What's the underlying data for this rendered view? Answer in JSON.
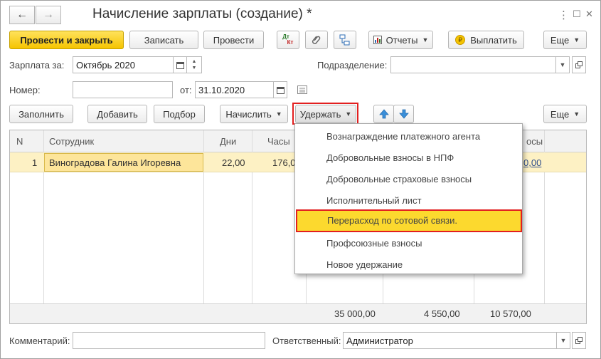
{
  "window": {
    "title": "Начисление зарплаты (создание) *",
    "back_icon": "←",
    "forward_icon": "→",
    "more_icon": "⋮",
    "maximize_icon": "☐",
    "close_icon": "✕"
  },
  "toolbar": {
    "post_close": "Провести и закрыть",
    "save": "Записать",
    "post": "Провести",
    "dt_kt_top": "Дт",
    "dt_kt_bottom": "Кт",
    "reports": "Отчеты",
    "pay": "Выплатить",
    "more": "Еще"
  },
  "form": {
    "salary_for_label": "Зарплата за:",
    "salary_for_value": "Октябрь 2020",
    "department_label": "Подразделение:",
    "department_value": "",
    "number_label": "Номер:",
    "number_value": "",
    "from_label": "от:",
    "date_value": "31.10.2020"
  },
  "table_toolbar": {
    "fill": "Заполнить",
    "add": "Добавить",
    "select": "Подбор",
    "accrue": "Начислить",
    "withhold": "Удержать",
    "more": "Еще"
  },
  "table": {
    "headers": [
      "N",
      "Сотрудник",
      "Дни",
      "Часы",
      "",
      "",
      "осы"
    ],
    "rows": [
      {
        "n": "1",
        "employee": "Виноградова Галина Игоревна",
        "days": "22,00",
        "hours": "176,0",
        "last": "0,00"
      }
    ],
    "totals": [
      "35 000,00",
      "4 550,00",
      "10 570,00"
    ]
  },
  "menu": {
    "items": [
      "Вознаграждение платежного агента",
      "Добровольные взносы в НПФ",
      "Добровольные страховые взносы",
      "Исполнительный лист",
      "Перерасход по сотовой связи.",
      "Профсоюзные взносы",
      "Новое удержание"
    ],
    "selected_index": 4
  },
  "bottom": {
    "comment_label": "Комментарий:",
    "comment_value": "",
    "responsible_label": "Ответственный:",
    "responsible_value": "Администратор"
  },
  "colors": {
    "accent_yellow": "#f5c400",
    "highlight_red": "#e21f1f",
    "row_selected": "#fdf1c4"
  }
}
